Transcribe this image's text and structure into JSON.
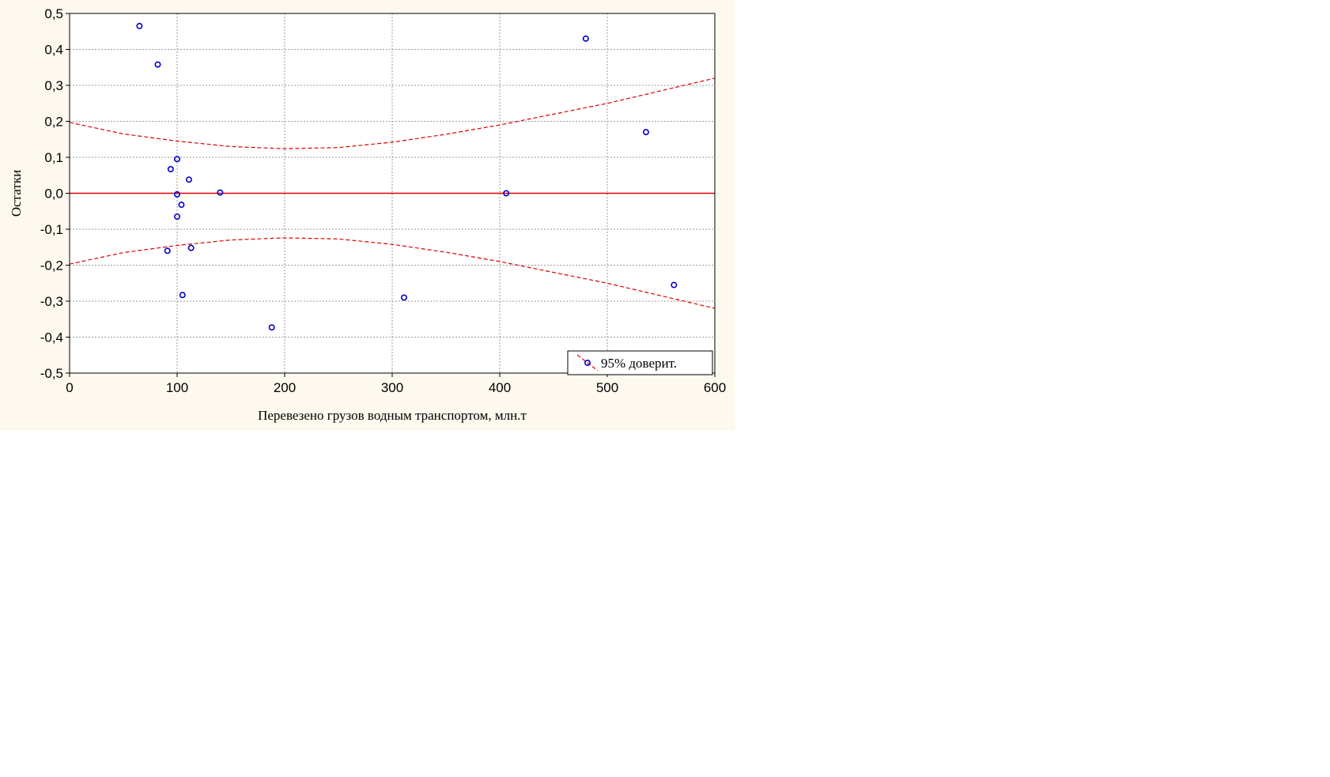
{
  "chart_data": {
    "type": "scatter",
    "title": "",
    "xlabel": "Перевезено грузов водным транспортом, млн.т",
    "ylabel": "Остатки",
    "xlim": [
      0,
      600
    ],
    "ylim": [
      -0.5,
      0.5
    ],
    "x_ticks": [
      0,
      100,
      200,
      300,
      400,
      500,
      600
    ],
    "x_tick_labels": [
      "0",
      "100",
      "200",
      "300",
      "400",
      "500",
      "600"
    ],
    "y_ticks": [
      -0.5,
      -0.4,
      -0.3,
      -0.2,
      -0.1,
      0.0,
      0.1,
      0.2,
      0.3,
      0.4,
      0.5
    ],
    "y_tick_labels": [
      "-0,5",
      "-0,4",
      "-0,3",
      "-0,2",
      "-0,1",
      "0,0",
      "0,1",
      "0,2",
      "0,3",
      "0,4",
      "0,5"
    ],
    "grid": true,
    "legend_position": "bottom-right",
    "legend_label": "95% доверит.",
    "colors": {
      "points": "#0000cc",
      "lines": "#dd0000",
      "background": "#fdf9ef"
    },
    "points": [
      {
        "x": 65,
        "y": 0.465
      },
      {
        "x": 82,
        "y": 0.358
      },
      {
        "x": 100,
        "y": 0.095
      },
      {
        "x": 94,
        "y": 0.067
      },
      {
        "x": 111,
        "y": 0.038
      },
      {
        "x": 140,
        "y": 0.002
      },
      {
        "x": 100,
        "y": -0.003
      },
      {
        "x": 104,
        "y": -0.032
      },
      {
        "x": 100,
        "y": -0.065
      },
      {
        "x": 91,
        "y": -0.16
      },
      {
        "x": 113,
        "y": -0.152
      },
      {
        "x": 105,
        "y": -0.283
      },
      {
        "x": 188,
        "y": -0.373
      },
      {
        "x": 311,
        "y": -0.29
      },
      {
        "x": 406,
        "y": 0.0
      },
      {
        "x": 480,
        "y": 0.43
      },
      {
        "x": 536,
        "y": 0.17
      },
      {
        "x": 562,
        "y": -0.255
      }
    ],
    "fit_line": {
      "x": [
        0,
        600
      ],
      "y": [
        0,
        0
      ]
    },
    "confidence_upper": {
      "x": [
        0,
        50,
        100,
        150,
        200,
        250,
        300,
        350,
        400,
        450,
        500,
        550,
        600
      ],
      "y": [
        0.197,
        0.165,
        0.145,
        0.13,
        0.124,
        0.127,
        0.142,
        0.164,
        0.19,
        0.22,
        0.25,
        0.285,
        0.32
      ]
    },
    "confidence_lower": {
      "x": [
        0,
        50,
        100,
        150,
        200,
        250,
        300,
        350,
        400,
        450,
        500,
        550,
        600
      ],
      "y": [
        -0.197,
        -0.165,
        -0.145,
        -0.13,
        -0.124,
        -0.127,
        -0.142,
        -0.164,
        -0.19,
        -0.22,
        -0.25,
        -0.285,
        -0.32
      ]
    }
  }
}
